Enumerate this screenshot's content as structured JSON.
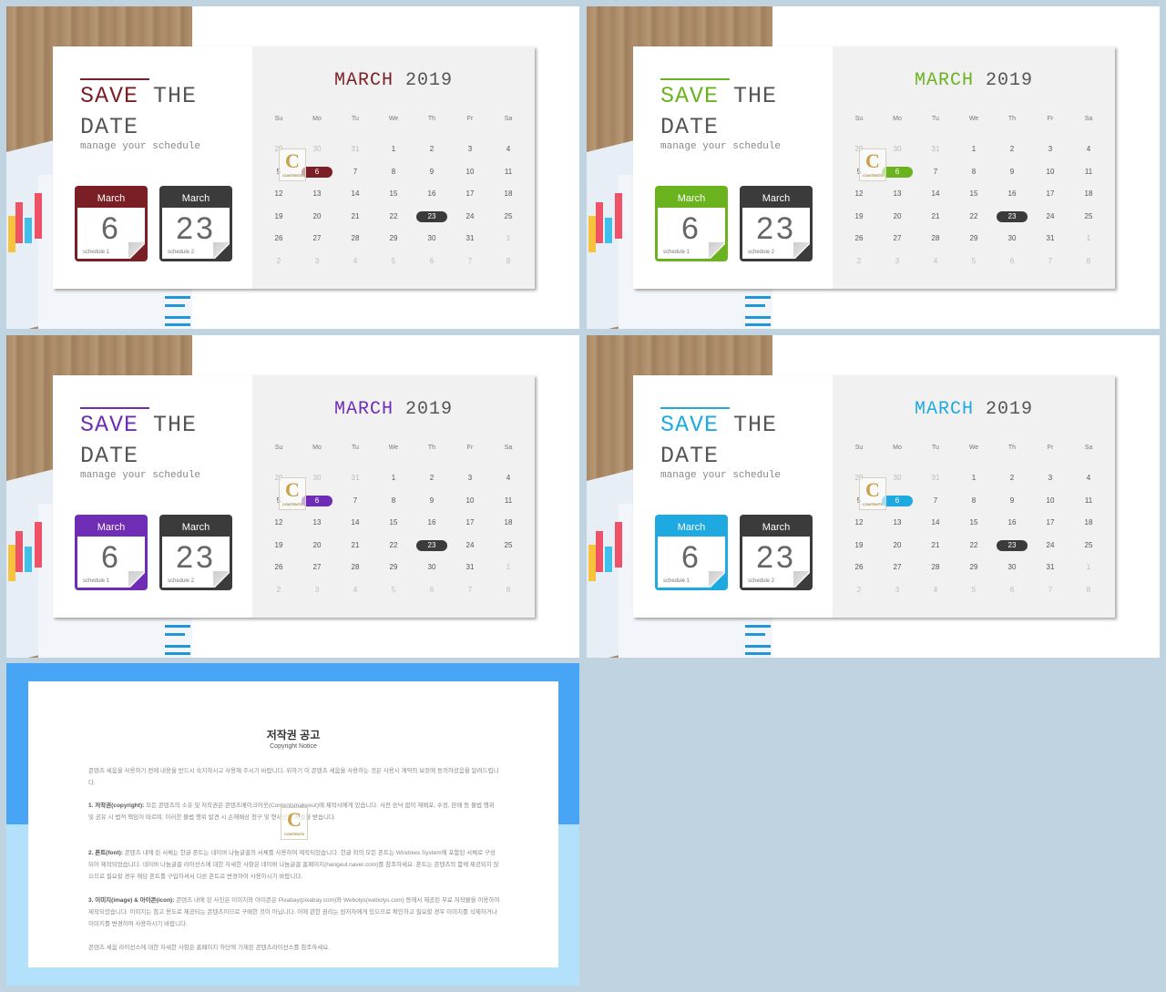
{
  "slides": [
    {
      "theme": "red",
      "accent": "#7a1f26",
      "title_word1": "SAVE",
      "title_word2": "THE",
      "title_word3": "DATE",
      "subtitle": "manage your schedule",
      "month_word": "MARCH",
      "year": "2019",
      "icon1": {
        "month": "March",
        "day": "6",
        "label": "schedule 1"
      },
      "icon2": {
        "month": "March",
        "day": "23",
        "label": "schedule 2"
      }
    },
    {
      "theme": "green",
      "accent": "#6bb31e",
      "title_word1": "SAVE",
      "title_word2": "THE",
      "title_word3": "DATE",
      "subtitle": "manage your schedule",
      "month_word": "MARCH",
      "year": "2019",
      "icon1": {
        "month": "March",
        "day": "6",
        "label": "schedule 1"
      },
      "icon2": {
        "month": "March",
        "day": "23",
        "label": "schedule 2"
      }
    },
    {
      "theme": "purple",
      "accent": "#6f2db5",
      "title_word1": "SAVE",
      "title_word2": "THE",
      "title_word3": "DATE",
      "subtitle": "manage your schedule",
      "month_word": "MARCH",
      "year": "2019",
      "icon1": {
        "month": "March",
        "day": "6",
        "label": "schedule 1"
      },
      "icon2": {
        "month": "March",
        "day": "23",
        "label": "schedule 2"
      }
    },
    {
      "theme": "blue",
      "accent": "#1ea9e1",
      "title_word1": "SAVE",
      "title_word2": "THE",
      "title_word3": "DATE",
      "subtitle": "manage your schedule",
      "month_word": "MARCH",
      "year": "2019",
      "icon1": {
        "month": "March",
        "day": "6",
        "label": "schedule 1"
      },
      "icon2": {
        "month": "March",
        "day": "23",
        "label": "schedule 2"
      }
    }
  ],
  "calendar": {
    "weekdays": [
      "Su",
      "Mo",
      "Tu",
      "We",
      "Th",
      "Fr",
      "Sa"
    ],
    "weeks": [
      [
        {
          "d": "29",
          "dim": true
        },
        {
          "d": "30",
          "dim": true
        },
        {
          "d": "31",
          "dim": true
        },
        {
          "d": "1"
        },
        {
          "d": "2"
        },
        {
          "d": "3"
        },
        {
          "d": "4"
        }
      ],
      [
        {
          "d": "5"
        },
        {
          "d": "6",
          "mark": "accent"
        },
        {
          "d": "7"
        },
        {
          "d": "8"
        },
        {
          "d": "9"
        },
        {
          "d": "10"
        },
        {
          "d": "11"
        }
      ],
      [
        {
          "d": "12"
        },
        {
          "d": "13"
        },
        {
          "d": "14"
        },
        {
          "d": "15"
        },
        {
          "d": "16"
        },
        {
          "d": "17"
        },
        {
          "d": "18"
        }
      ],
      [
        {
          "d": "19"
        },
        {
          "d": "20"
        },
        {
          "d": "21"
        },
        {
          "d": "22"
        },
        {
          "d": "23",
          "mark": "dark"
        },
        {
          "d": "24"
        },
        {
          "d": "25"
        }
      ],
      [
        {
          "d": "26"
        },
        {
          "d": "27"
        },
        {
          "d": "28"
        },
        {
          "d": "29"
        },
        {
          "d": "30"
        },
        {
          "d": "31"
        },
        {
          "d": "1",
          "dim": true
        }
      ],
      [
        {
          "d": "2",
          "dim": true
        },
        {
          "d": "3",
          "dim": true
        },
        {
          "d": "4",
          "dim": true
        },
        {
          "d": "5",
          "dim": true
        },
        {
          "d": "6",
          "dim": true
        },
        {
          "d": "7",
          "dim": true
        },
        {
          "d": "8",
          "dim": true
        }
      ]
    ],
    "dark_color": "#3b3b3b"
  },
  "watermark": {
    "letter": "C",
    "text": "CONTENTS"
  },
  "copyright": {
    "title": "저작권 공고",
    "subtitle": "Copyright Notice",
    "intro": "콘텐츠 세움을 사용하기 전에 내용을 반드시 숙지하시고 사용해 주시기 바랍니다. 위하기 이 콘텐츠 세움을 사용하는 것은 사용시 계약의 보장에 동의하셨음을 알려드립니다.",
    "sections": [
      {
        "heading": "1. 저작권(copyright):",
        "text": "모든 콘텐츠의 소유 및 저작권은 콘텐츠메이크어웃(Contentsmakeout)에 제작사에게 있습니다. 사전 승낙 없이 재배포, 수정, 판매 등 불법 행위 및 공유 시 법적 책임이 따르며, 이러한 불법 행위 발견 시 손해배상 청구 및 형사상의 처벌을 받습니다."
      },
      {
        "heading": "2. 폰트(font):",
        "text": "콘텐츠 내에 된 서체는 한글 폰트는 네이버 나눔글꼴의 서체를 사용하여 제작되었습니다. 한글 외의 모든 폰트는 Windows System에 포함된 서체로 구성되어 제작되었습니다. 네이버 나눔글꼴 라이선스에 대한 자세한 사항은 네이버 나눔글꼴 홈페이지(hangeul.naver.com)를 참조하세요. 폰트는 콘텐츠의 함께 제공되지 않으므로 필요할 경우 해당 폰트를 구입하셔서 다른 폰트로 변경하여 사용하시기 바랍니다."
      },
      {
        "heading": "3. 이미지(image) & 아이콘(icon):",
        "text": "콘텐츠 내에 된 사진은 이미지와 아이콘은 Pixabay(pixabay.com)와 Webolys(webolys.com) 등에서 제공된 무료 저작물을 이용하여 제작되었습니다. 이미지는 참고 용도로 제공되는 콘텐츠이므로 구매한 것이 아닙니다. 이에 관한 권리는 원저자에게 있으므로 확인하고 필요할 경우 이미지를 삭제하거나 이미지를 변경하여 사용하시기 바랍니다."
      }
    ],
    "footer": "콘텐츠 세움 라이선스에 대한 자세한 사항은 홈페이지 하단에 기재된 콘텐츠라이선스를 참조하세요."
  }
}
